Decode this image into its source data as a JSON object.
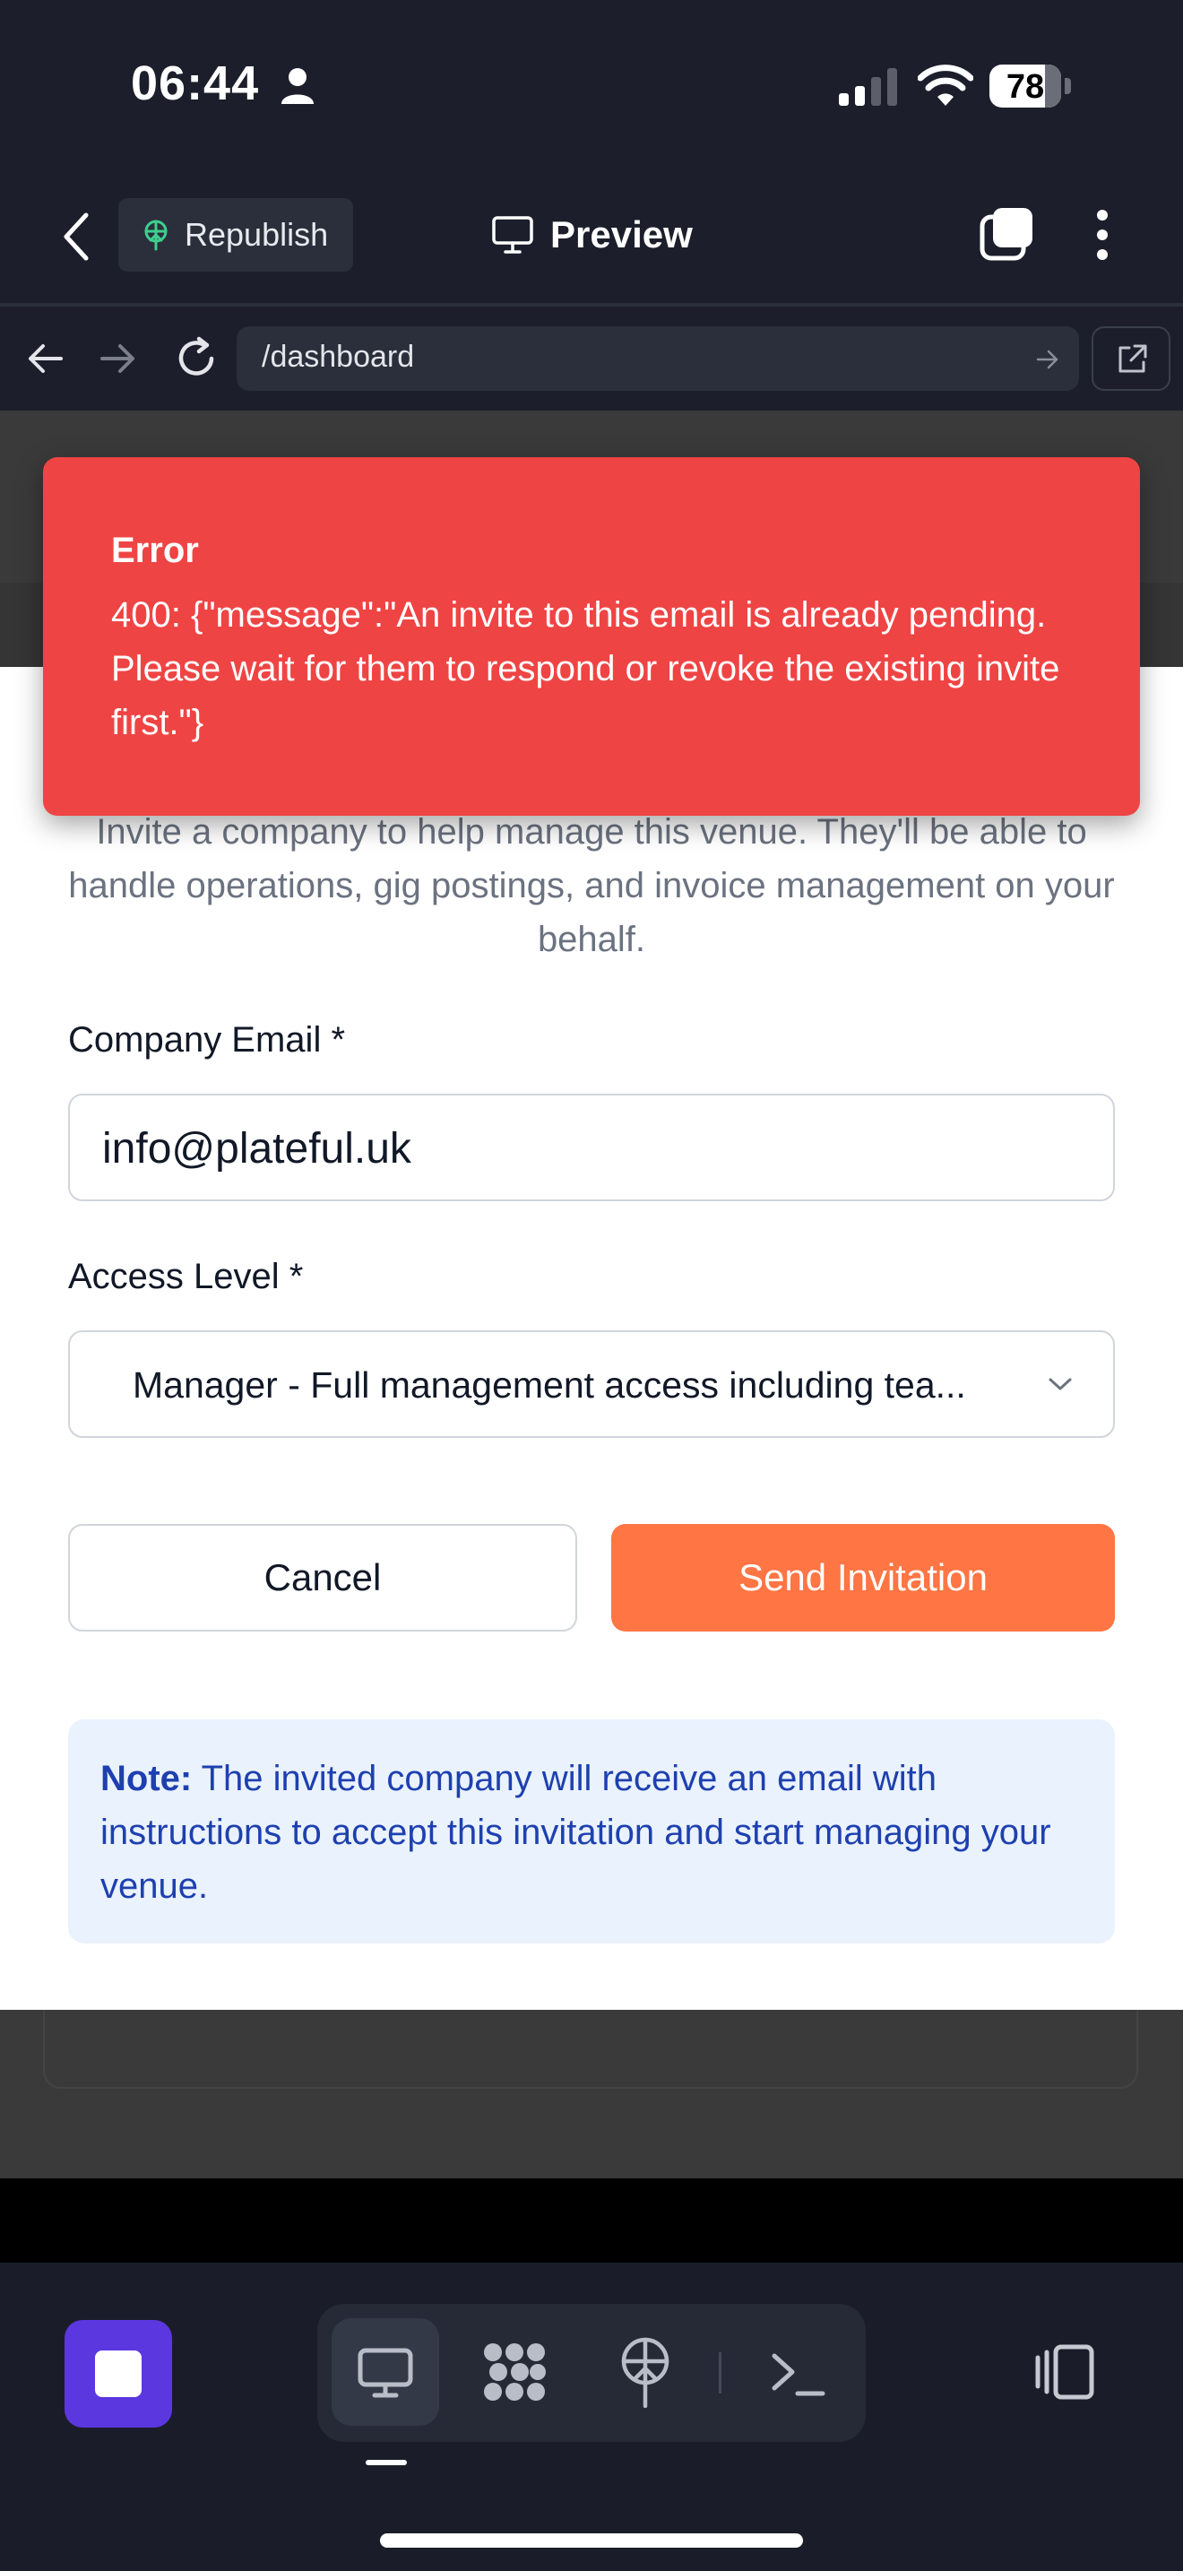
{
  "status_bar": {
    "time": "06:44",
    "battery": "78"
  },
  "header": {
    "republish_label": "Republish",
    "preview_label": "Preview"
  },
  "browser": {
    "url": "/dashboard"
  },
  "toast": {
    "title": "Error",
    "message": "400: {\"message\":\"An invite to this email is already pending. Please wait for them to respond or revoke the existing invite first.\"}"
  },
  "modal": {
    "description": "Invite a company to help manage this venue. They'll be able to handle operations, gig postings, and invoice management on your behalf.",
    "email_label": "Company Email *",
    "email_value": "info@plateful.uk",
    "access_label": "Access Level *",
    "access_value": "Manager - Full management access including tea...",
    "cancel_label": "Cancel",
    "send_label": "Send Invitation",
    "note_bold": "Note:",
    "note_text": " The invited company will receive an email with instructions to accept this invitation and start managing your venue."
  },
  "colors": {
    "toast_bg": "#ef4444",
    "accent": "#ff7543",
    "stop_button": "#5b37e0",
    "note_bg": "#eaf2fe",
    "note_text": "#1e40af"
  },
  "icons": [
    "person-icon",
    "signal-icon",
    "wifi-icon",
    "battery-icon",
    "back-chevron-icon",
    "deploy-icon",
    "monitor-icon",
    "tabs-icon",
    "more-icon",
    "arrow-left-icon",
    "arrow-right-icon",
    "reload-icon",
    "open-external-icon",
    "chevron-down-icon",
    "stop-icon",
    "desktop-icon",
    "apps-icon",
    "shell-icon",
    "panel-icon"
  ]
}
